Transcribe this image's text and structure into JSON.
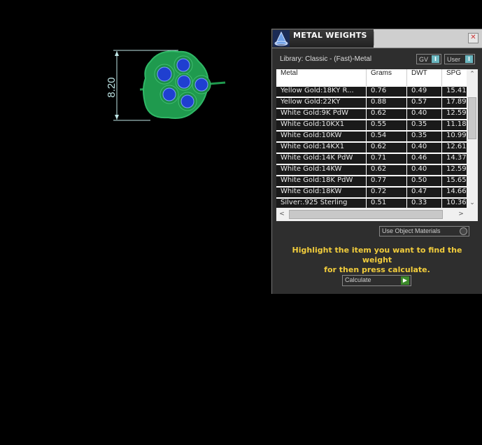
{
  "viewport": {
    "dimension": "8.20"
  },
  "panel": {
    "title": "METAL WEIGHTS",
    "close_label": "✕",
    "library_label": "Library: Classic - (Fast)-Metal",
    "toggle_gv": "GV",
    "toggle_user": "User",
    "toggle_knob": "I",
    "columns": [
      "Metal",
      "Grams",
      "DWT",
      "SPG"
    ],
    "rows": [
      [
        "Yellow Gold:18KY R...",
        "0.76",
        "0.49",
        "15.41"
      ],
      [
        "Yellow Gold:22KY",
        "0.88",
        "0.57",
        "17.89"
      ],
      [
        "White Gold:9K PdW",
        "0.62",
        "0.40",
        "12.59"
      ],
      [
        "White Gold:10KX1",
        "0.55",
        "0.35",
        "11.18"
      ],
      [
        "White Gold:10KW",
        "0.54",
        "0.35",
        "10.99"
      ],
      [
        "White Gold:14KX1",
        "0.62",
        "0.40",
        "12.61"
      ],
      [
        "White Gold:14K PdW",
        "0.71",
        "0.46",
        "14.37"
      ],
      [
        "White Gold:14KW",
        "0.62",
        "0.40",
        "12.59"
      ],
      [
        "White Gold:18K PdW",
        "0.77",
        "0.50",
        "15.65"
      ],
      [
        "White Gold:18KW",
        "0.72",
        "0.47",
        "14.66"
      ],
      [
        "Silver:.925 Sterling",
        "0.51",
        "0.33",
        "10.36"
      ]
    ],
    "use_object_materials": "Use Object Materials",
    "instruction_line1": "Highlight the item you want to find the weight",
    "instruction_line2": "for then press calculate.",
    "calculate_label": "Calculate",
    "calculate_icon": "▶"
  },
  "colors": {
    "accent_teal": "#6bb7c0",
    "instruction_yellow": "#f2cd3c",
    "model_green": "#1f9a4e",
    "gem_blue": "#1f3fd0"
  }
}
